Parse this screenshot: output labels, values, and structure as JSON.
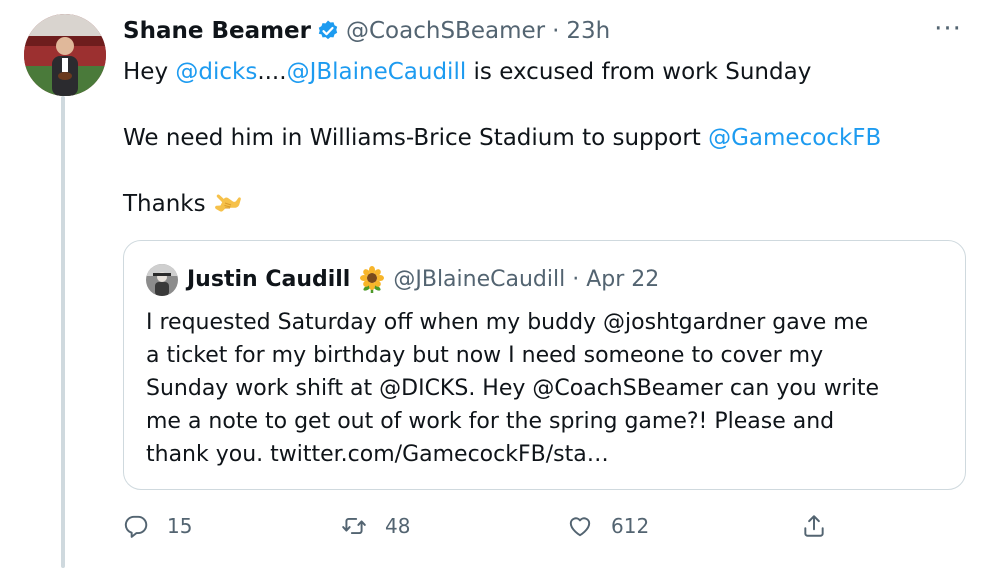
{
  "tweet": {
    "author_name": "Shane Beamer",
    "handle": "@CoachSBeamer",
    "separator": "·",
    "time": "23h",
    "more_label": "···",
    "lines": [
      [
        {
          "text": "Hey ",
          "type": "text"
        },
        {
          "text": "@dicks",
          "type": "mention"
        },
        {
          "text": "....",
          "type": "text"
        },
        {
          "text": "@JBlaineCaudill",
          "type": "mention"
        },
        {
          "text": " is excused from work Sunday",
          "type": "text"
        }
      ],
      [
        {
          "text": "We need him in Williams-Brice Stadium to support ",
          "type": "text"
        },
        {
          "text": "@GamecockFB",
          "type": "mention"
        }
      ],
      [
        {
          "text": "Thanks",
          "type": "text"
        }
      ]
    ],
    "emoji": "call-me-hand"
  },
  "quote": {
    "author_name": "Justin Caudill",
    "emoji": "sunflower",
    "handle": "@JBlaineCaudill",
    "separator": "·",
    "date": "Apr 22",
    "lines": [
      "I requested Saturday off when my buddy @joshtgardner gave me",
      "a ticket for my birthday but now I need someone to cover my",
      "Sunday work shift at @DICKS. Hey @CoachSBeamer can you write",
      "me a note to get out of work for the spring game?! Please and",
      "thank you. twitter.com/GamecockFB/sta…"
    ]
  },
  "actions": {
    "reply_count": "15",
    "retweet_count": "48",
    "like_count": "612"
  },
  "colors": {
    "link": "#1d9bf0",
    "muted": "#536471",
    "text": "#0f1419",
    "border": "#cfd9de",
    "verified": "#1d9bf0"
  }
}
